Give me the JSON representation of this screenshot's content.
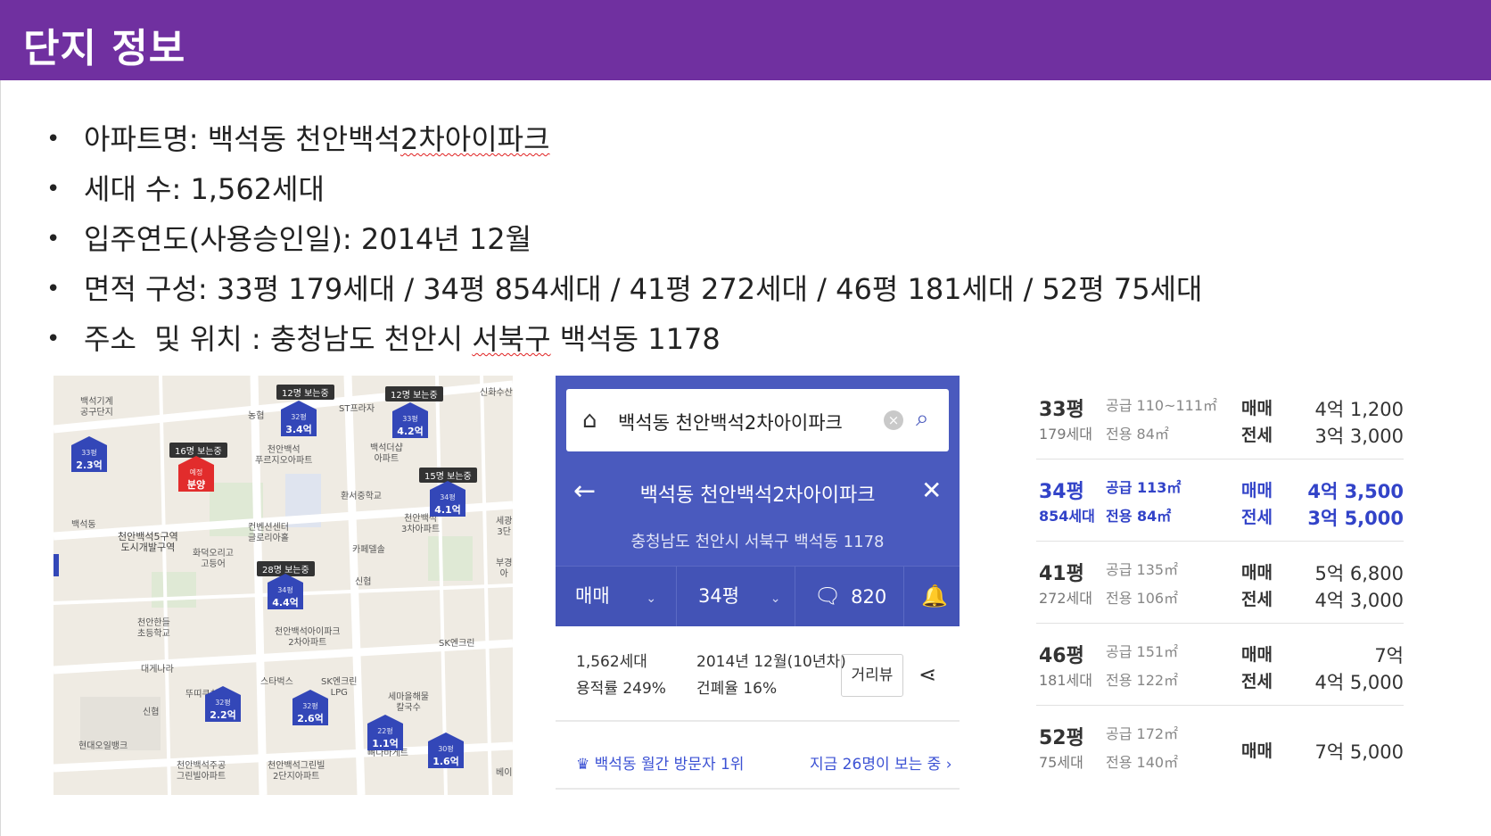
{
  "header": {
    "title": "단지 정보"
  },
  "bullets": [
    {
      "label": "아파트명: 백석동 천안백석",
      "squiggle": "2차아이파크",
      "rest": ""
    },
    {
      "label": "세대 수: 1,562세대",
      "squiggle": "",
      "rest": ""
    },
    {
      "label": "입주연도(사용승인일): 2014년 12월",
      "squiggle": "",
      "rest": ""
    },
    {
      "label": "면적 구성: 33평 179세대 / 34평 854세대 / 41평 272세대 / 46평 181세대 / 52평 75세대",
      "squiggle": "",
      "rest": ""
    },
    {
      "label": "주소  및 위치 : 충청남도 천안시 ",
      "squiggle": "서북구",
      "rest": " 백석동 1178"
    }
  ],
  "map": {
    "pins": [
      {
        "py": "33평",
        "price": "2.3억"
      },
      {
        "py": "32평",
        "price": "3.4억"
      },
      {
        "py": "33평",
        "price": "4.2억"
      },
      {
        "py": "예정",
        "price": "분양"
      },
      {
        "py": "34평",
        "price": "4.1억"
      },
      {
        "py": "34평",
        "price": "4.4억"
      },
      {
        "py": "32평",
        "price": "2.2억"
      },
      {
        "py": "32평",
        "price": "2.6억"
      },
      {
        "py": "22평",
        "price": "1.1억"
      },
      {
        "py": "30평",
        "price": "1.6억"
      }
    ],
    "chips": [
      "12명 보는중",
      "12명 보는중",
      "16명 보는중",
      "15명 보는중",
      "28명 보는중"
    ],
    "labels": {
      "l1": "백석기계\n공구단지",
      "l2": "천안백석\n푸르지오아파트",
      "l3": "백석더샵\n아파트",
      "l4": "컨벤션센터\n글로리아홀",
      "l5": "천안백석5구역\n도시개발구역",
      "l6": "백석동",
      "l7": "천안백석아이파크\n2차아파트",
      "l8": "천안한들\n초등학교",
      "l9": "천안백석주공\n그린빌아파트",
      "l10": "천안백석그린빌\n2단지아파트",
      "l11": "현대오일뱅크",
      "l12": "SK엔크린\nLPG",
      "l13": "SK엔크린",
      "l14": "스타벅스",
      "l15": "농협",
      "l16": "ST프라자",
      "l17": "신화수산",
      "l18": "환서중학교",
      "l19": "천안백석\n3차아파트",
      "l20": "화덕오리고\n고등어",
      "l21": "카페델솔",
      "l22": "뚜띠쿠치나",
      "l23": "대게나라",
      "l24": "신협",
      "l25": "신협",
      "l26": "세광\n3단",
      "l27": "부경\n아",
      "l28": "세마을해물\n칼국수",
      "l29": "뼈다바게트",
      "l30": "베이"
    }
  },
  "app": {
    "search_text": "백석동 천안백석2차아이파크",
    "nav_title": "백석동 천안백석2차아이파크",
    "address": "충청남도 천안시 서북구 백석동 1178",
    "tab_trade": "매매",
    "tab_size": "34평",
    "comments": "820",
    "households": "1,562세대",
    "far": "용적률 249%",
    "built": "2014년 12월(10년차)",
    "bcr": "건폐율 16%",
    "street_view": "거리뷰",
    "visitor_rank": "백석동 월간 방문자 1위",
    "viewing_now": "지금 26명이 보는 중"
  },
  "price_table": [
    {
      "py": "33평",
      "households": "179세대",
      "supply": "공급 110~111㎡",
      "exclusive": "전용 84㎡",
      "type1": "매매",
      "price1": "4억 1,200",
      "type2": "전세",
      "price2": "3억 3,000"
    },
    {
      "py": "34평",
      "households": "854세대",
      "supply": "공급 113㎡",
      "exclusive": "전용 84㎡",
      "type1": "매매",
      "price1": "4억 3,500",
      "type2": "전세",
      "price2": "3억 5,000"
    },
    {
      "py": "41평",
      "households": "272세대",
      "supply": "공급 135㎡",
      "exclusive": "전용 106㎡",
      "type1": "매매",
      "price1": "5억 6,800",
      "type2": "전세",
      "price2": "4억 3,000"
    },
    {
      "py": "46평",
      "households": "181세대",
      "supply": "공급 151㎡",
      "exclusive": "전용 122㎡",
      "type1": "매매",
      "price1": "7억",
      "type2": "전세",
      "price2": "4억 5,000"
    },
    {
      "py": "52평",
      "households": "75세대",
      "supply": "공급 172㎡",
      "exclusive": "전용 140㎡",
      "type1": "매매",
      "price1": "7억 5,000"
    }
  ],
  "colors": {
    "header": "#7030a0",
    "app_blue": "#4a5abe",
    "pin_blue": "#3347b8",
    "highlight": "#3243c8"
  }
}
